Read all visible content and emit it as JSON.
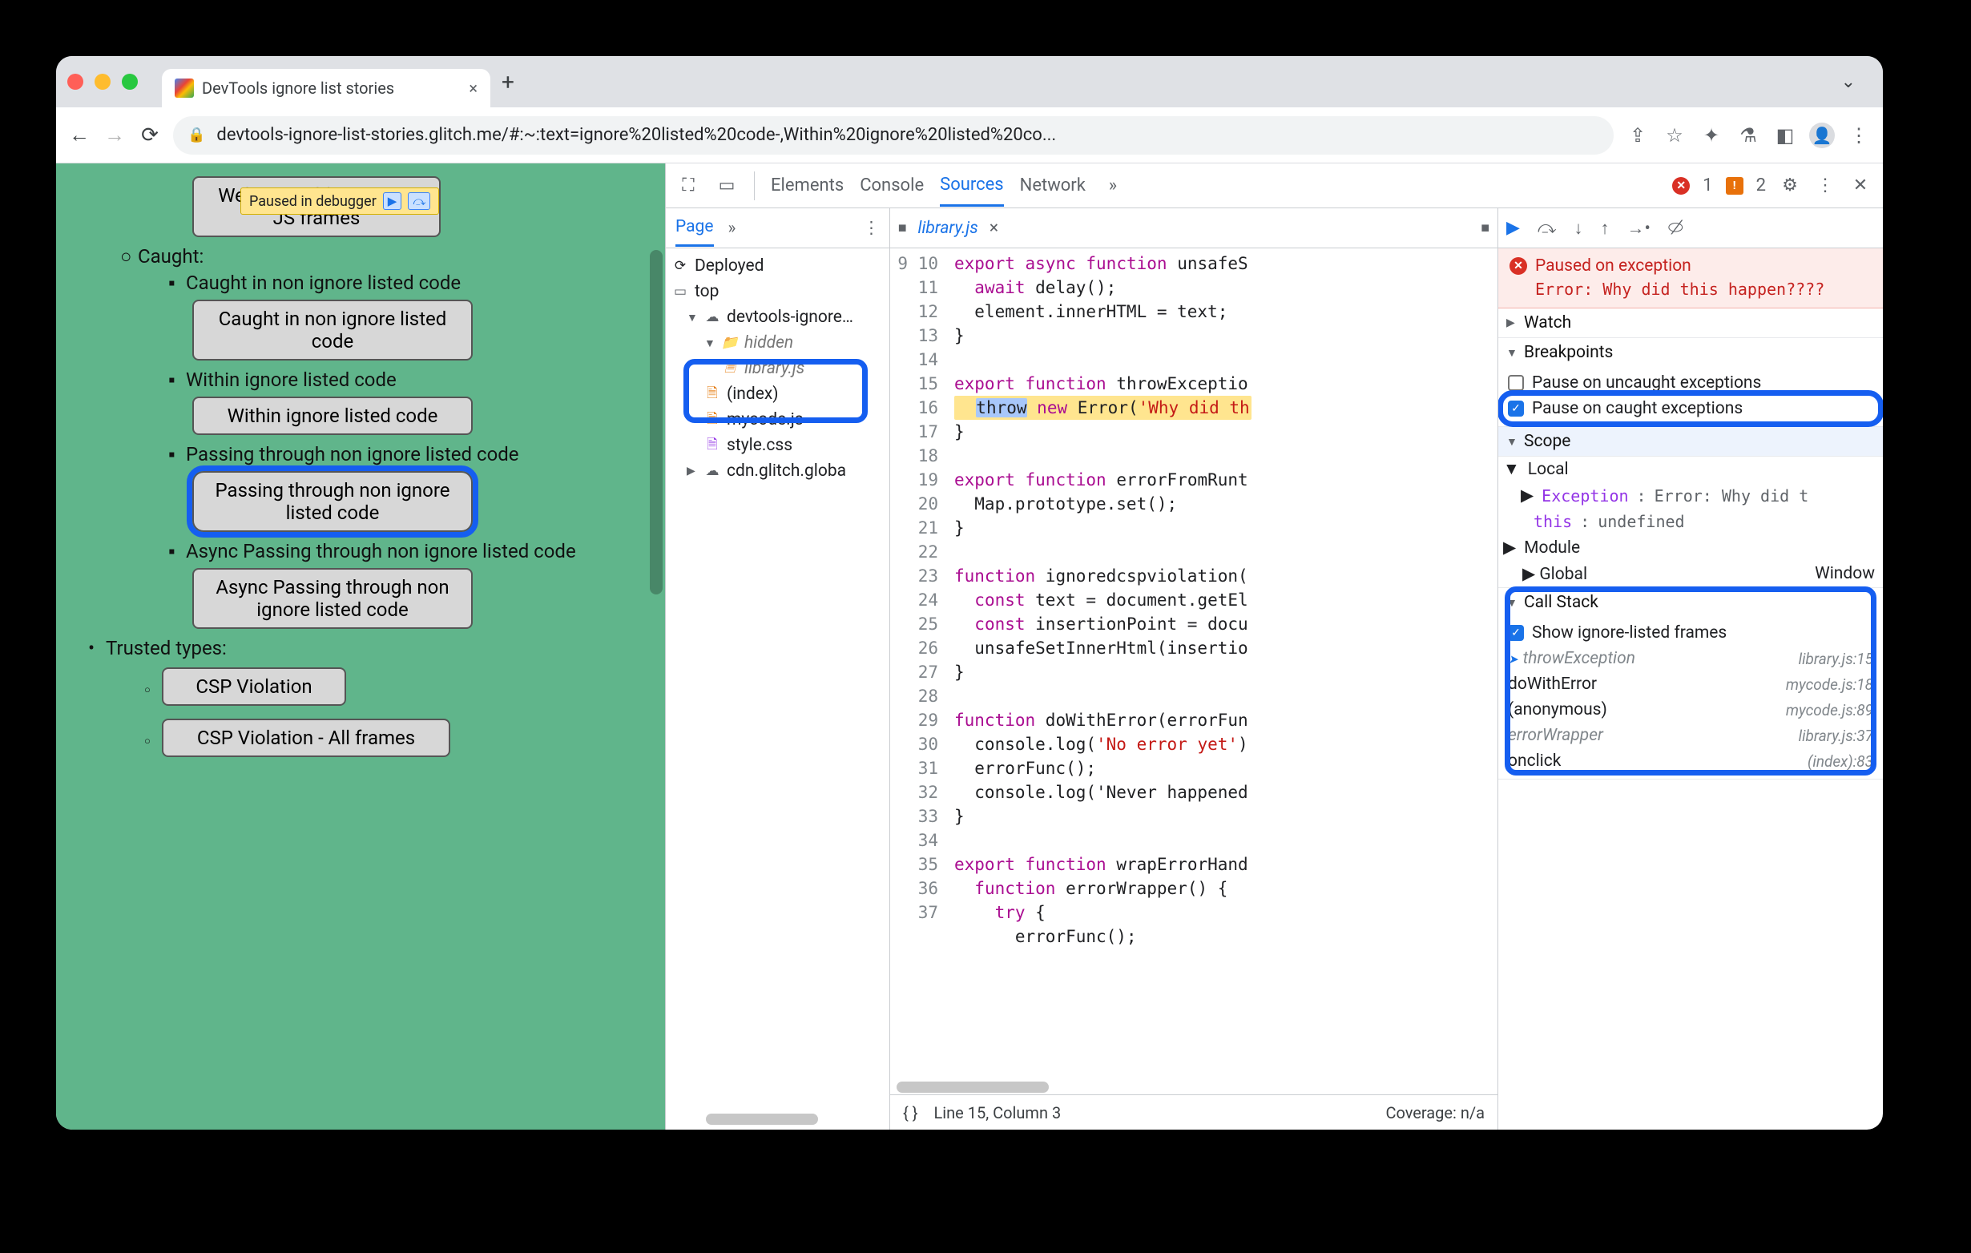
{
  "browser": {
    "tab_title": "DevTools ignore list stories",
    "url": "devtools-ignore-list-stories.glitch.me/#:~:text=ignore%20listed%20code-,Within%20ignore%20listed%20co..."
  },
  "paused_pill": {
    "label": "Paused in debugger"
  },
  "page": {
    "items": {
      "wasm": "WebAssembly trap - no JS frames",
      "caught_h": "Caught:",
      "caught1_label": "Caught in non ignore listed code",
      "caught1_btn": "Caught in non ignore listed code",
      "within_label": "Within ignore listed code",
      "within_btn": "Within ignore listed code",
      "pass_label": "Passing through non ignore listed code",
      "pass_btn": "Passing through non ignore listed code",
      "async_label": "Async Passing through non ignore listed code",
      "async_btn": "Async Passing through non ignore listed code",
      "trusted_h": "Trusted types:",
      "csp_btn": "CSP Violation",
      "csp_all_btn": "CSP Violation - All frames"
    }
  },
  "devtools": {
    "tabs": {
      "elements": "Elements",
      "console": "Console",
      "sources": "Sources",
      "network": "Network"
    },
    "errors": 1,
    "issues": 2
  },
  "navigator": {
    "page_tab": "Page",
    "nodes": {
      "deployed": "Deployed",
      "top": "top",
      "origin": "devtools-ignore…",
      "hidden": "hidden",
      "library": "library.js",
      "index": "(index)",
      "mycode": "mycode.js",
      "style": "style.css",
      "cdn": "cdn.glitch.globa"
    }
  },
  "editor": {
    "filename": "library.js",
    "lines_start": 9,
    "lines": [
      "export async function unsafeS",
      "  await delay();",
      "  element.innerHTML = text;",
      "}",
      "",
      "export function throwExceptio",
      "  throw new Error('Why did th",
      "}",
      "",
      "export function errorFromRunt",
      "  Map.prototype.set();",
      "}",
      "",
      "function ignoredcspviolation(",
      "  const text = document.getEl",
      "  const insertionPoint = docu",
      "  unsafeSetInnerHtml(insertio",
      "}",
      "",
      "function doWithError(errorFun",
      "  console.log('No error yet')",
      "  errorFunc();",
      "  console.log('Never happened",
      "}",
      "",
      "export function wrapErrorHand",
      "  function errorWrapper() {",
      "    try {",
      "      errorFunc();"
    ],
    "status_line": "Line 15, Column 3",
    "coverage": "Coverage: n/a"
  },
  "debugger": {
    "banner_title": "Paused on exception",
    "banner_msg": "Error: Why did this happen????",
    "sections": {
      "watch": "Watch",
      "breakpoints": "Breakpoints",
      "scope": "Scope",
      "callstack": "Call Stack"
    },
    "breakpoints": {
      "uncaught": "Pause on uncaught exceptions",
      "caught": "Pause on caught exceptions"
    },
    "scope": {
      "local": "Local",
      "exception_key": "Exception",
      "exception_val": "Error: Why did t",
      "this_key": "this",
      "this_val": "undefined",
      "module": "Module",
      "global": "Global",
      "global_val": "Window"
    },
    "callstack": {
      "show_ignored": "Show ignore-listed frames",
      "frames": [
        {
          "name": "throwException",
          "loc": "library.js:15",
          "ignored": true,
          "current": true
        },
        {
          "name": "doWithError",
          "loc": "mycode.js:18",
          "ignored": false,
          "current": false
        },
        {
          "name": "(anonymous)",
          "loc": "mycode.js:89",
          "ignored": false,
          "current": false
        },
        {
          "name": "errorWrapper",
          "loc": "library.js:37",
          "ignored": true,
          "current": false
        },
        {
          "name": "onclick",
          "loc": "(index):83",
          "ignored": false,
          "current": false
        }
      ]
    }
  }
}
